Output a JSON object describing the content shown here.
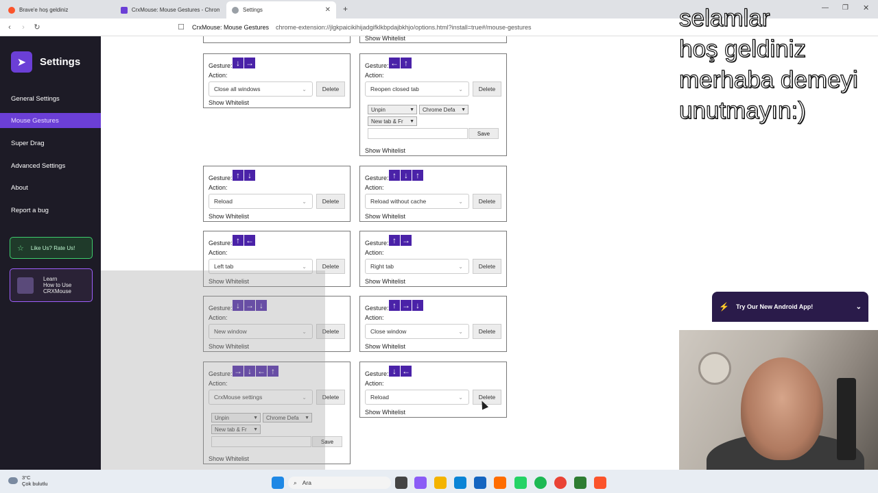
{
  "browser": {
    "tabs": [
      {
        "title": "Brave'e hoş geldiniz"
      },
      {
        "title": "CrxMouse: Mouse Gestures - Chrom"
      },
      {
        "title": "Settings"
      }
    ],
    "site_name": "CrxMouse: Mouse Gestures",
    "url": "chrome-extension://jlgkpaicikihijadgifklkbpdajbkhjo/options.html?install=true#/mouse-gestures"
  },
  "sidebar": {
    "title": "Settings",
    "items": [
      {
        "label": "General Settings"
      },
      {
        "label": "Mouse Gestures"
      },
      {
        "label": "Super Drag"
      },
      {
        "label": "Advanced Settings"
      },
      {
        "label": "About"
      },
      {
        "label": "Report a bug"
      }
    ],
    "rate_label": "Like Us? Rate Us!",
    "learn_line1": "Learn",
    "learn_line2": "How to Use",
    "learn_line3": "CRXMouse"
  },
  "labels": {
    "gesture": "Gesture:",
    "action": "Action:",
    "delete": "Delete",
    "whitelist": "Show Whitelist",
    "save": "Save",
    "opt_unpin": "Unpin",
    "opt_chrome": "Chrome Defa",
    "opt_newtab": "New tab & Fr"
  },
  "top_whitelist": "Show Whitelist",
  "cards": [
    {
      "arrows": [
        "↓",
        "→"
      ],
      "action": "Close all windows"
    },
    {
      "arrows": [
        "←",
        "↑"
      ],
      "action": "Reopen closed tab"
    },
    {
      "arrows": [
        "↑",
        "↓"
      ],
      "action": "Reload"
    },
    {
      "arrows": [
        "↑",
        "↓",
        "↑"
      ],
      "action": "Reload without cache"
    },
    {
      "arrows": [
        "↑",
        "←"
      ],
      "action": "Left tab"
    },
    {
      "arrows": [
        "↑",
        "→"
      ],
      "action": "Right tab"
    },
    {
      "arrows": [
        "↓",
        "→",
        "↓"
      ],
      "action": "New window"
    },
    {
      "arrows": [
        "↑",
        "→",
        "↓"
      ],
      "action": "Close window"
    },
    {
      "arrows": [
        "→",
        "↓",
        "←",
        "↑"
      ],
      "action": "CrxMouse settings"
    },
    {
      "arrows": [
        "↓",
        "←"
      ],
      "action": "Reload"
    }
  ],
  "overlay_text": [
    "selamlar",
    "hoş geldiniz",
    "merhaba demeyi",
    "unutmayın:)"
  ],
  "android_banner": "Try Our New Android App!",
  "taskbar": {
    "weather_temp": "3°C",
    "weather_desc": "Çok bulutlu",
    "search_placeholder": "Ara"
  },
  "colors": {
    "accent": "#6b3fd6",
    "arrow_bg": "#4a22a8",
    "sidebar_bg": "#1d1b26"
  }
}
